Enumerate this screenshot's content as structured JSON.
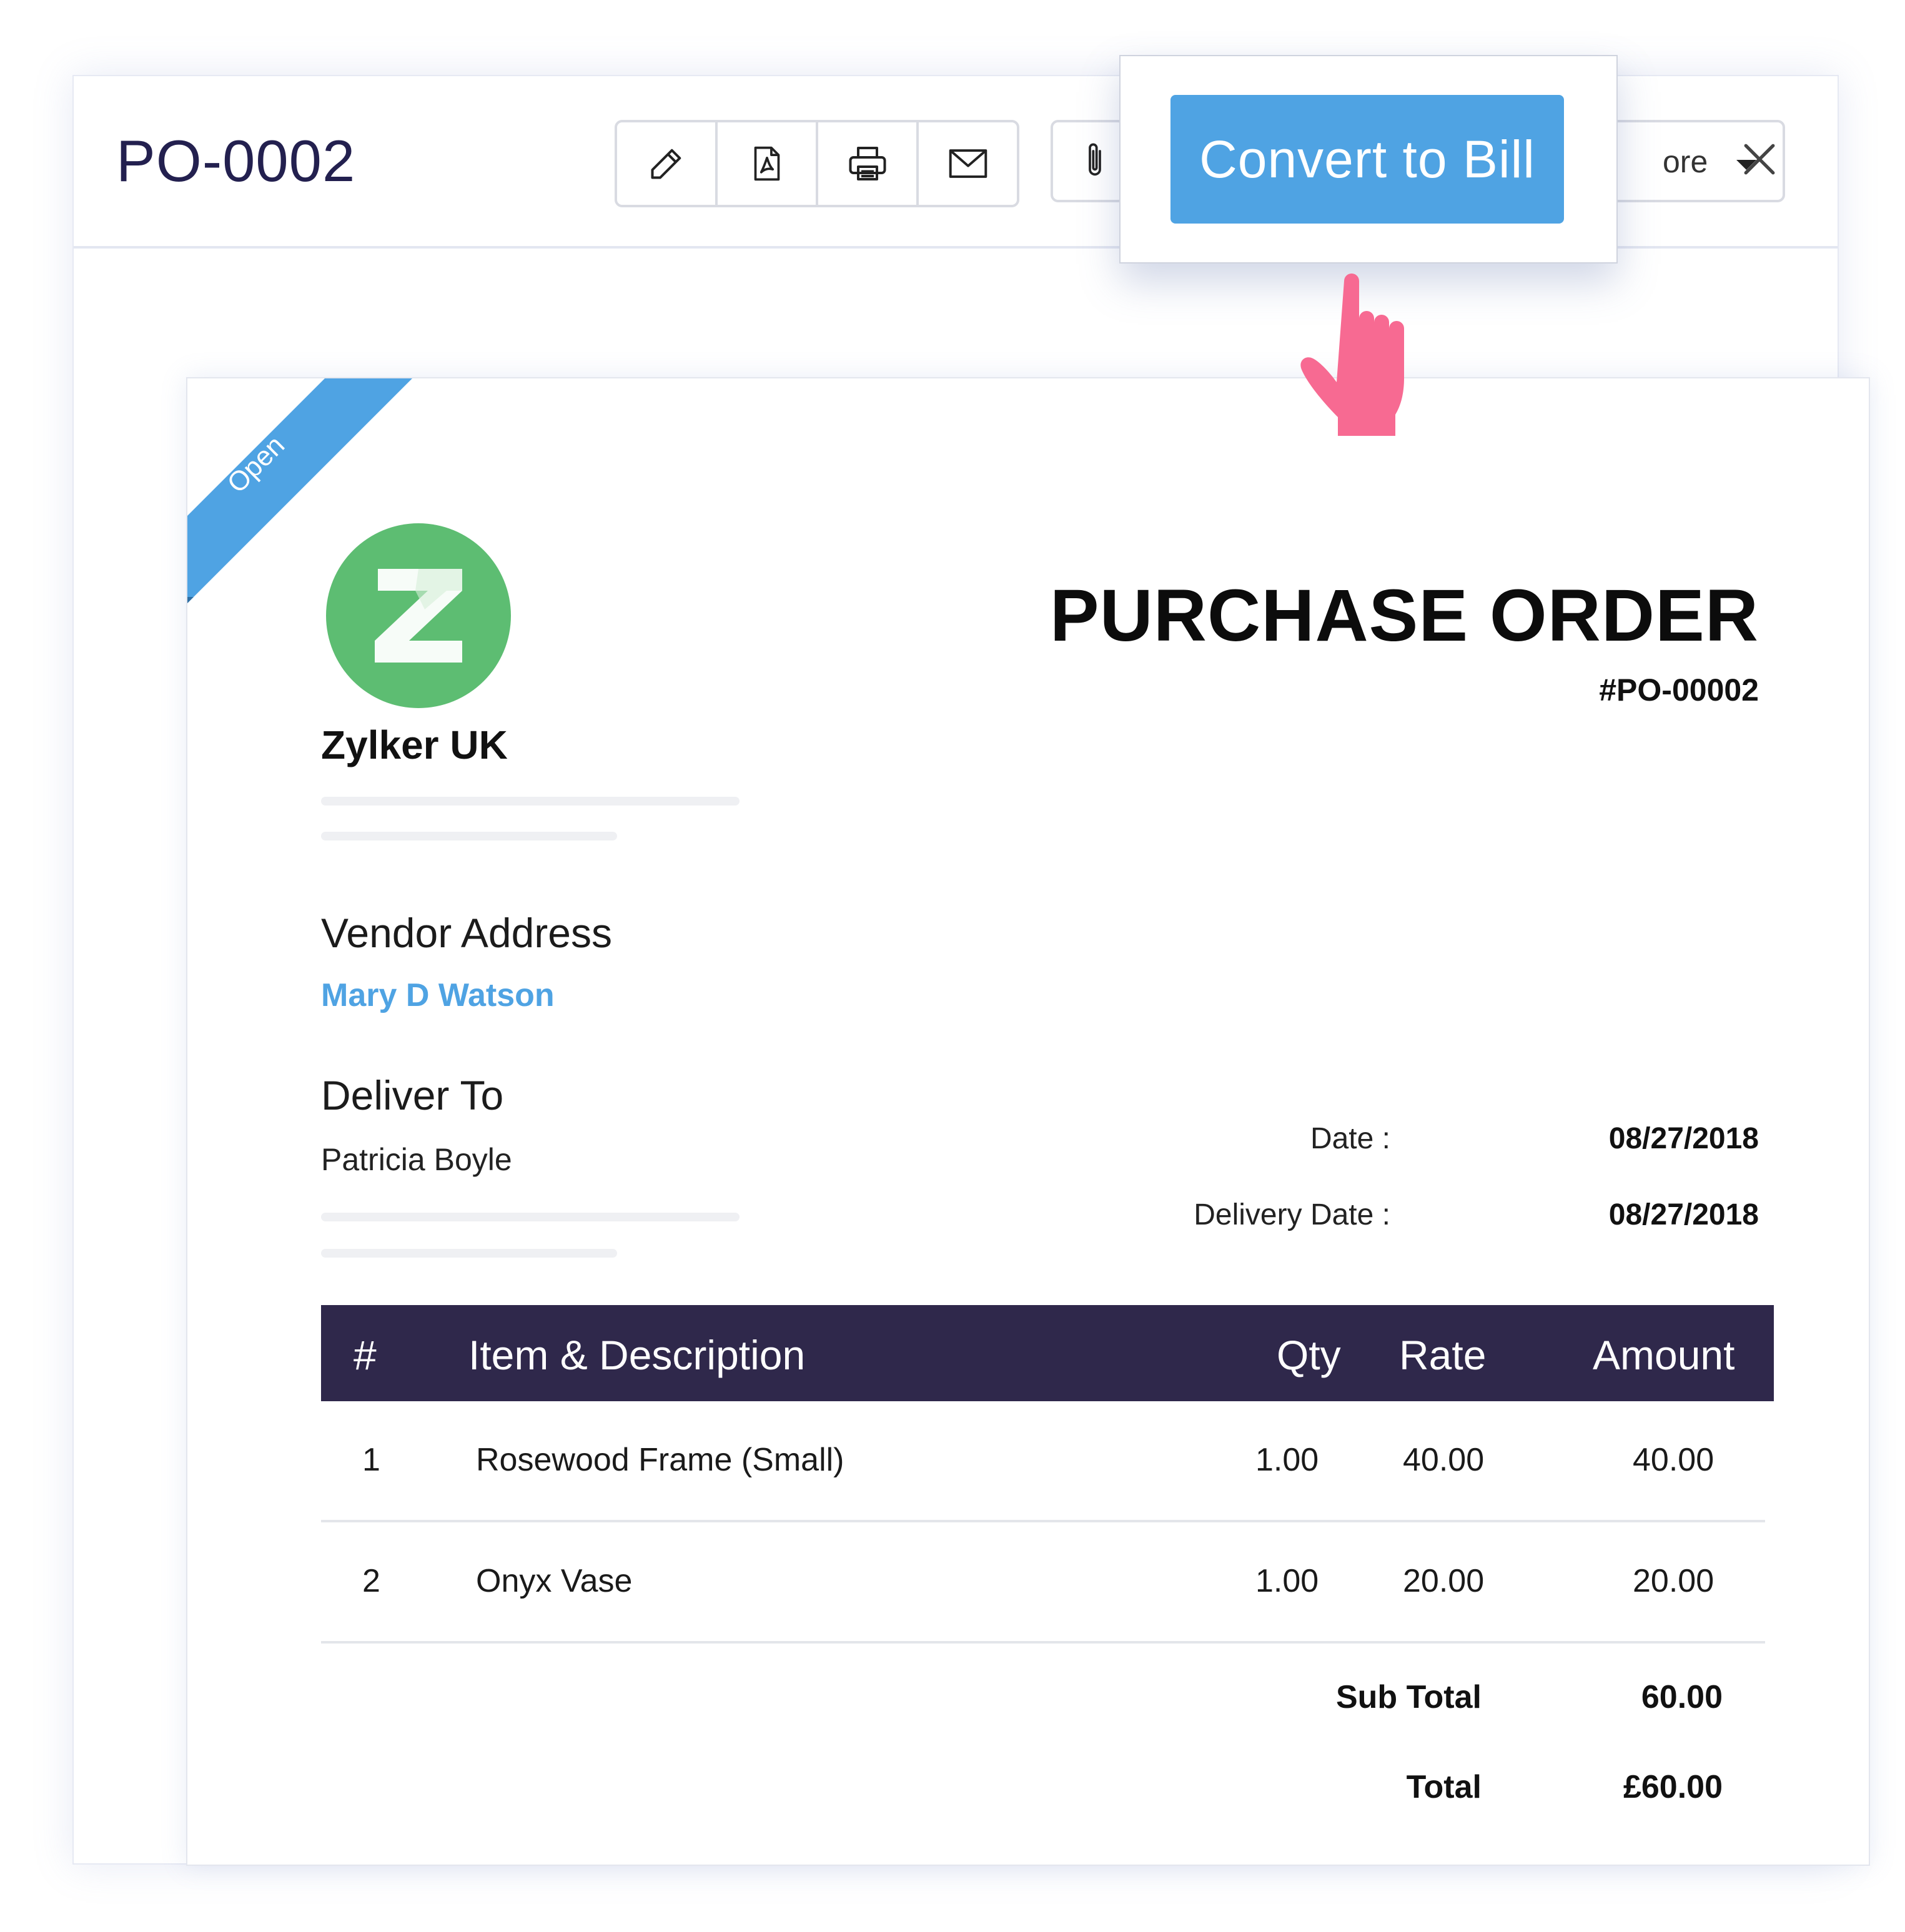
{
  "header": {
    "po_title": "PO-0002",
    "more_label": "ore",
    "icons": [
      "pencil-icon",
      "pdf-icon",
      "printer-icon",
      "envelope-icon",
      "paperclip-icon",
      "caret-down-icon",
      "close-icon"
    ]
  },
  "popover": {
    "convert_label": "Convert to Bill"
  },
  "document": {
    "status_ribbon": "Open",
    "logo_letter": "Z",
    "company_name": "Zylker UK",
    "title": "PURCHASE ORDER",
    "number": "#PO-00002",
    "vendor_heading": "Vendor Address",
    "vendor_name": "Mary D Watson",
    "deliver_heading": "Deliver To",
    "deliver_name": "Patricia Boyle",
    "meta": [
      {
        "label": "Date :",
        "value": "08/27/2018"
      },
      {
        "label": "Delivery Date :",
        "value": "08/27/2018"
      }
    ],
    "table": {
      "headers": [
        "#",
        "Item & Description",
        "Qty",
        "Rate",
        "Amount"
      ],
      "rows": [
        [
          "1",
          "Rosewood Frame (Small)",
          "1.00",
          "40.00",
          "40.00"
        ],
        [
          "2",
          "Onyx Vase",
          "1.00",
          "20.00",
          "20.00"
        ]
      ]
    },
    "totals": [
      {
        "label": "Sub Total",
        "value": "60.00"
      },
      {
        "label": "Total",
        "value": "£60.00"
      }
    ]
  },
  "colors": {
    "accent": "#4fa3e3",
    "header_dark": "#2f284b",
    "title_text": "#23204f",
    "logo_green": "#5dbd72",
    "hand_pink": "#f76a92"
  }
}
